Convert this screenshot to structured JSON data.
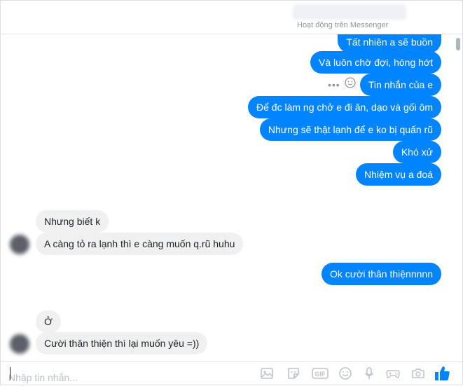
{
  "header": {
    "status": "Hoạt động trên Messenger"
  },
  "messages": [
    {
      "dir": "out",
      "text": "Tất nhiên a sẽ buồn"
    },
    {
      "dir": "out",
      "text": "Và luôn chờ đợi, hóng hớt"
    },
    {
      "dir": "out",
      "text": "Tin nhắn của e"
    },
    {
      "dir": "out",
      "text": "Để đc làm ng chở e đi ăn, dạo và gối ôm"
    },
    {
      "dir": "out",
      "text": "Nhưng sẽ thật lạnh để e ko bị quấn rũ"
    },
    {
      "dir": "out",
      "text": "Khó xử"
    },
    {
      "dir": "out",
      "text": "Nhiệm vụ a đoá"
    },
    {
      "dir": "in",
      "text": "Nhưng biết k"
    },
    {
      "dir": "in",
      "text": "A càng tỏ ra lạnh thì e càng muốn q.rũ huhu"
    },
    {
      "dir": "out",
      "text": "Ok cười thân thiệnnnnn"
    },
    {
      "dir": "in",
      "text": "Ở"
    },
    {
      "dir": "in",
      "text": "Cười thân thiện thì lại muốn yêu =))"
    }
  ],
  "message_actions": {
    "more": "•••",
    "icon": "emoji-reaction-icon"
  },
  "composer": {
    "placeholder": "Nhập tin nhắn...",
    "tools": [
      "photo-icon",
      "sticker-icon",
      "gif-icon",
      "emoji-icon",
      "microphone-icon",
      "game-icon",
      "camera-icon",
      "like-icon"
    ]
  },
  "colors": {
    "outgoing": "#0084ff",
    "incoming": "#f1f0f0",
    "accent": "#0084ff"
  }
}
